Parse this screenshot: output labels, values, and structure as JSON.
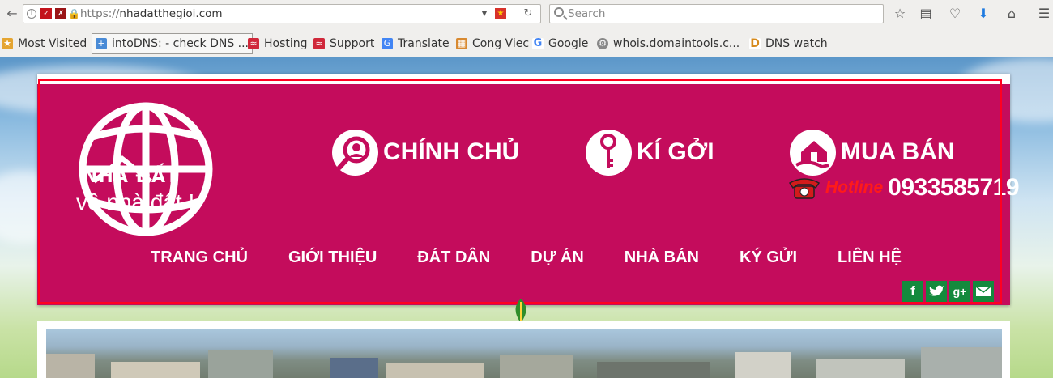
{
  "browser": {
    "url_scheme": "https://",
    "url_host": "nhadatthegioi.com",
    "search_placeholder": "Search"
  },
  "bookmarks": [
    {
      "label": "Most Visited",
      "icon": "most-visited-icon"
    },
    {
      "label": "intoDNS: - check DNS ...",
      "icon": "intodns-icon"
    },
    {
      "label": "Hosting",
      "icon": "hosting-icon"
    },
    {
      "label": "Support",
      "icon": "support-icon"
    },
    {
      "label": "Translate",
      "icon": "translate-icon"
    },
    {
      "label": "Cong Viec",
      "icon": "folder-icon"
    },
    {
      "label": "Google",
      "icon": "google-icon"
    },
    {
      "label": "whois.domaintools.c...",
      "icon": "whois-icon"
    },
    {
      "label": "DNS watch",
      "icon": "dnswatch-icon"
    }
  ],
  "site": {
    "logo_text": "NHÀ ĐẤT",
    "slogan": "Tin tức về nhà đất !",
    "features": [
      {
        "label": "CHÍNH CHỦ",
        "icon": "owner-search-icon"
      },
      {
        "label": "KÍ GỞI",
        "icon": "key-icon"
      },
      {
        "label": "MUA BÁN",
        "icon": "house-hand-icon"
      }
    ],
    "hotline_label": "Hotline",
    "hotline_number": "0933585719",
    "menu": [
      "TRANG CHỦ",
      "GIỚI THIỆU",
      "ĐÁT DÂN",
      "DỰ ÁN",
      "NHÀ BÁN",
      "KÝ GỬI",
      "LIÊN HỆ"
    ],
    "social": [
      {
        "label": "f",
        "icon": "facebook-icon"
      },
      {
        "label": "",
        "icon": "twitter-icon"
      },
      {
        "label": "g+",
        "icon": "google-plus-icon"
      },
      {
        "label": "",
        "icon": "email-icon"
      }
    ]
  },
  "colors": {
    "header_bg": "#c40c5c",
    "highlight_border": "#ff0021",
    "social_bg": "#148a3d"
  }
}
